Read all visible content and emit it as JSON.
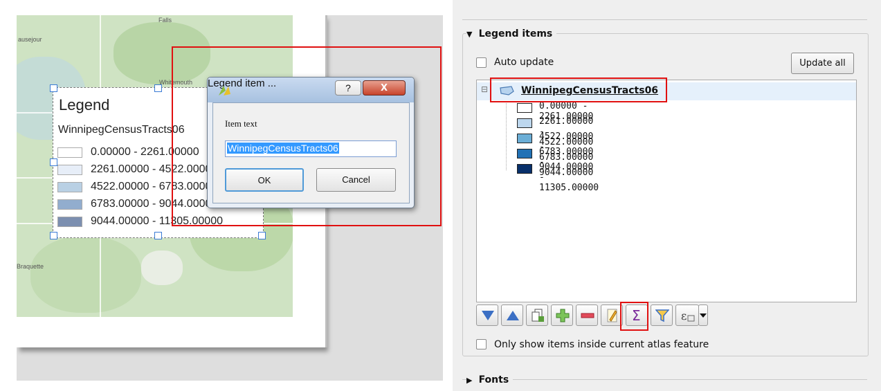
{
  "canvas": {
    "place_names": [
      "Falls",
      "ausejour",
      "Whitemouth",
      "Braquette"
    ],
    "legend": {
      "title": "Legend",
      "layer_name": "WinnipegCensusTracts06",
      "items": [
        {
          "label": "0.00000 - 2261.00000",
          "color": "#ffffff"
        },
        {
          "label": "2261.00000 - 4522.00000",
          "color": "#e7eef8"
        },
        {
          "label": "4522.00000 - 6783.00000",
          "color": "#b9d0e4"
        },
        {
          "label": "6783.00000 - 9044.00000",
          "color": "#92adce"
        },
        {
          "label": "9044.00000 - 11305.00000",
          "color": "#7c8fb0"
        }
      ]
    }
  },
  "dialog": {
    "title": "Legend item ...",
    "help_label": "?",
    "close_label": "X",
    "field_label": "Item text",
    "field_value": "WinnipegCensusTracts06",
    "ok_label": "OK",
    "cancel_label": "Cancel"
  },
  "panel": {
    "legend_items_header": "Legend items",
    "auto_update_label": "Auto update",
    "auto_update_checked": false,
    "update_all_label": "Update all",
    "tree": {
      "expander": "⊟",
      "layer_name": "WinnipegCensusTracts06",
      "classes": [
        {
          "label": "0.00000 - 2261.00000",
          "color": "#ffffff"
        },
        {
          "label": "2261.00000 - 4522.00000",
          "color": "#bdd7ee"
        },
        {
          "label": "4522.00000 - 6783.00000",
          "color": "#6baed6"
        },
        {
          "label": "6783.00000 - 9044.00000",
          "color": "#2171b5"
        },
        {
          "label": "9044.00000 - 11305.00000",
          "color": "#08306b"
        }
      ]
    },
    "toolbar": {
      "move_down_icon": "arrow-down-icon",
      "move_up_icon": "arrow-up-icon",
      "add_group_icon": "add-group-icon",
      "add_icon": "plus-icon",
      "remove_icon": "minus-icon",
      "edit_icon": "pencil-edit-icon",
      "count_icon": "sigma-icon",
      "filter_icon": "filter-icon",
      "expression_icon": "expression-icon",
      "expression_label": "ε"
    },
    "atlas_only_label": "Only show items inside current atlas feature",
    "atlas_only_checked": false,
    "fonts_header": "Fonts"
  }
}
